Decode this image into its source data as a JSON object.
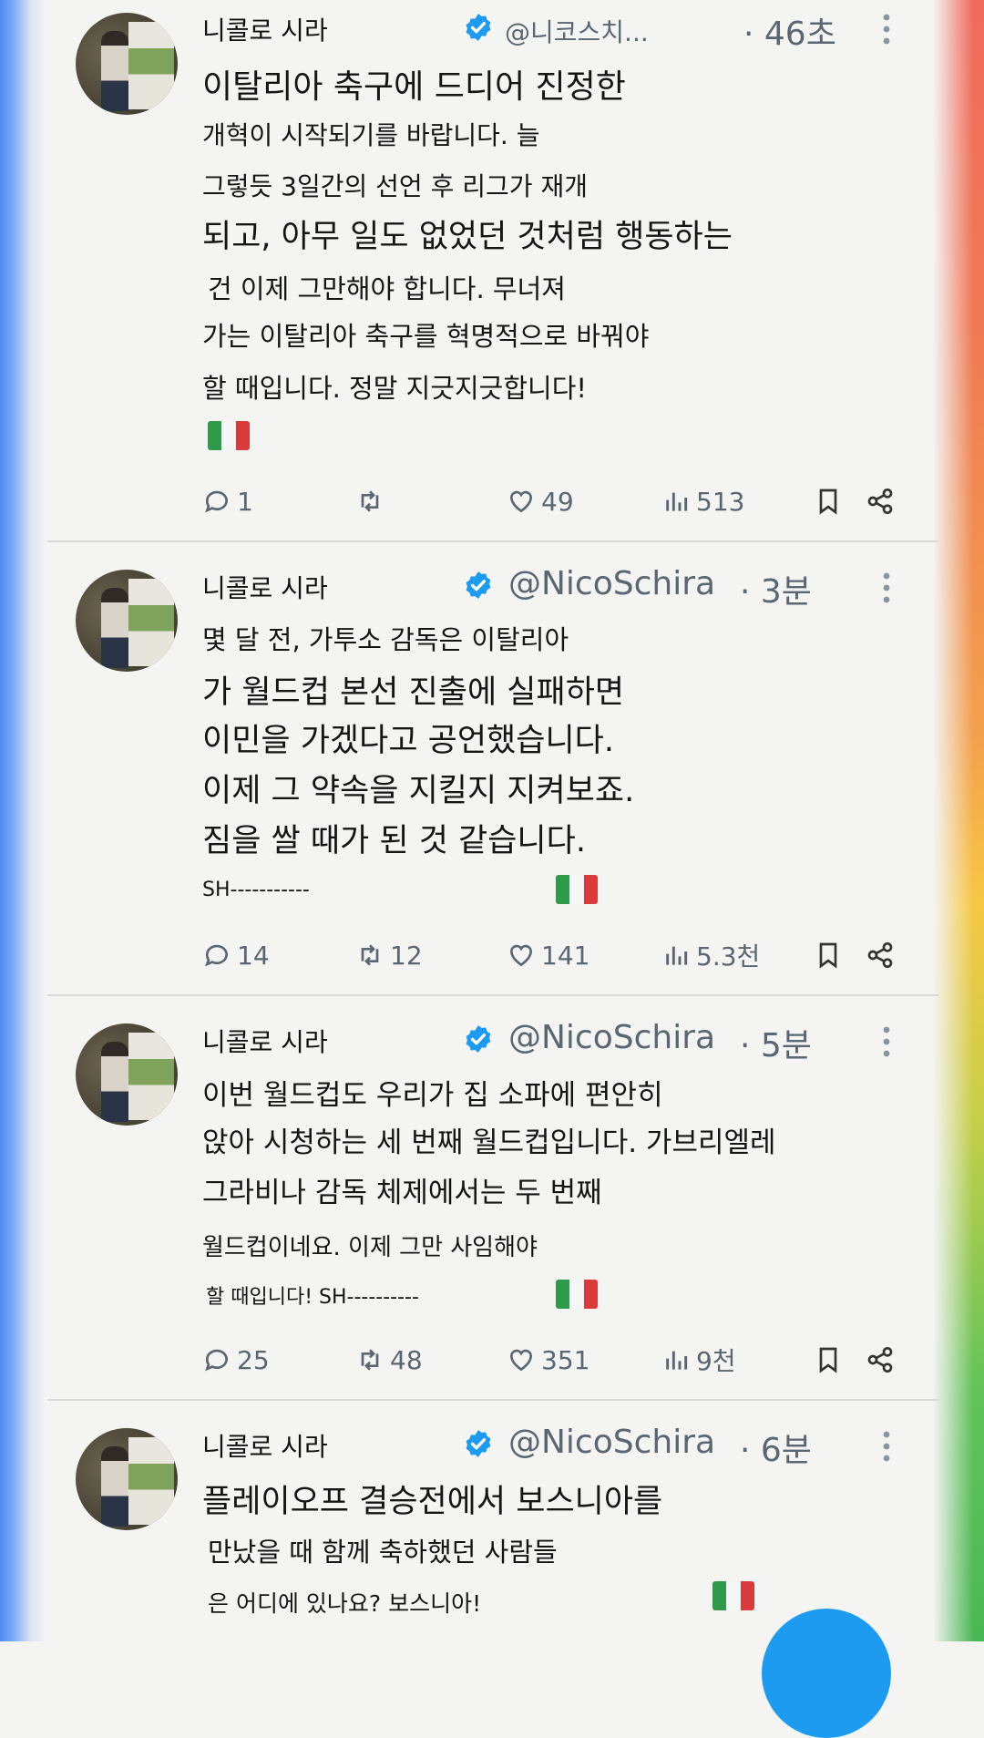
{
  "colors": {
    "accent": "#1d9bf0",
    "muted_text": "#5b6670",
    "flag": [
      "#2e9a4a",
      "#f6f6f6",
      "#d93a3a"
    ]
  },
  "tweets": [
    {
      "name": "니콜로 시라",
      "handle": "@니코스치...",
      "time": "· 46초",
      "lines": [
        "이탈리아 축구에 드디어 진정한",
        "개혁이 시작되기를 바랍니다. 늘",
        "그렇듯 3일간의 선언 후 리그가 재개",
        "되고, 아무 일도 없었던 것처럼 행동하는",
        "건 이제 그만해야 합니다. 무너져",
        "가는 이탈리아 축구를 혁명적으로 바꿔야",
        "할 때입니다. 정말 지긋지긋합니다!"
      ],
      "flag": "italy-flag",
      "replies": "1",
      "retweets": "",
      "likes": "49",
      "views": "513"
    },
    {
      "name": "니콜로 시라",
      "handle": "@NicoSchira",
      "time": "· 3분",
      "lines": [
        "몇 달 전, 가투소 감독은 이탈리아",
        "가 월드컵 본선 진출에 실패하면",
        "이민을 가겠다고 공언했습니다.",
        "이제 그 약속을 지킬지 지켜보죠.",
        "짐을 쌀 때가 된 것 같습니다.",
        "SH-----------"
      ],
      "flag": "italy-flag",
      "replies": "14",
      "retweets": "12",
      "likes": "141",
      "views": "5.3천"
    },
    {
      "name": "니콜로 시라",
      "handle": "@NicoSchira",
      "time": "· 5분",
      "lines": [
        "이번 월드컵도 우리가 집 소파에 편안히",
        "앉아 시청하는 세 번째 월드컵입니다. 가브리엘레",
        "그라비나 감독 체제에서는 두 번째",
        "월드컵이네요. 이제 그만 사임해야",
        "할 때입니다! SH----------"
      ],
      "flag": "italy-flag",
      "replies": "25",
      "retweets": "48",
      "likes": "351",
      "views": "9천"
    },
    {
      "name": "니콜로 시라",
      "handle": "@NicoSchira",
      "time": "· 6분",
      "lines": [
        "플레이오프 결승전에서 보스니아를",
        "만났을 때 함께 축하했던 사람들",
        "은 어디에 있나요? 보스니아!"
      ],
      "flag": "italy-flag"
    }
  ]
}
